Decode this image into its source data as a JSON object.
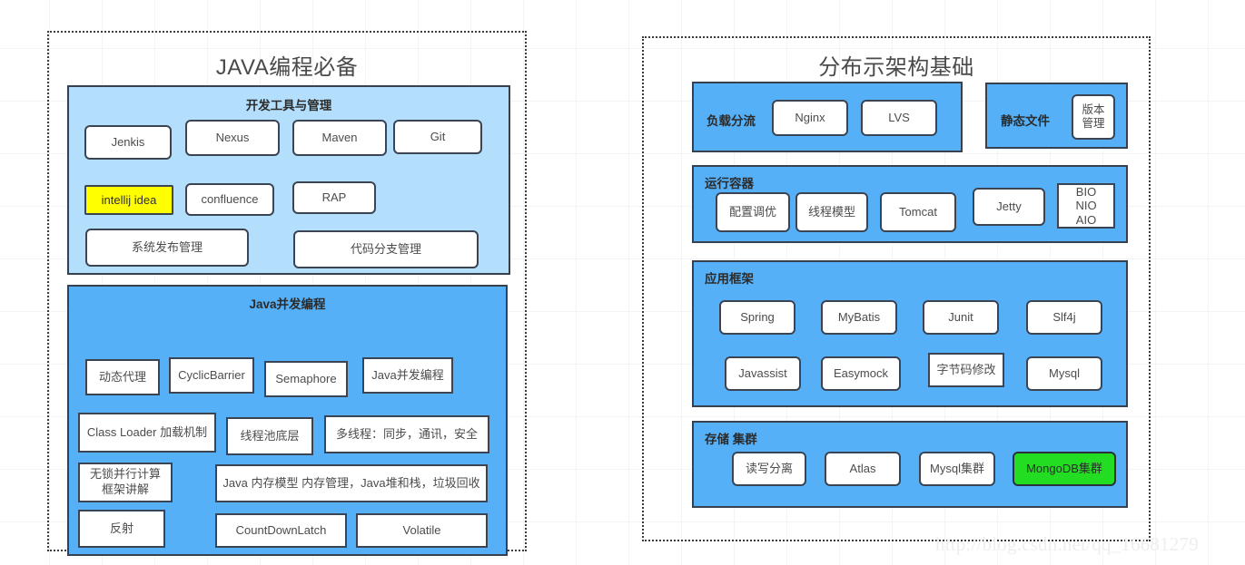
{
  "background": {
    "grid_color": "#f4f4f6",
    "page_color": "#ffffff"
  },
  "colors": {
    "light_blue": "#b3dffc",
    "solid_blue": "#56b0f7",
    "box_border": "#3b4452",
    "highlight_yellow": "#ffff00",
    "highlight_green": "#22dd22",
    "title_text": "#4a4a4a"
  },
  "left_panel": {
    "title": "JAVA编程必备",
    "groups": [
      {
        "title": "开发工具与管理",
        "items": [
          {
            "label": "Jenkis"
          },
          {
            "label": "Nexus"
          },
          {
            "label": "Maven"
          },
          {
            "label": "Git"
          },
          {
            "label": "intellij idea",
            "highlight": "yellow"
          },
          {
            "label": "confluence"
          },
          {
            "label": "RAP"
          },
          {
            "label": "系统发布管理"
          },
          {
            "label": "代码分支管理"
          }
        ]
      },
      {
        "title": "Java并发编程",
        "items": [
          {
            "label": "动态代理"
          },
          {
            "label": "CyclicBarrier"
          },
          {
            "label": "Semaphore"
          },
          {
            "label": "Java并发编程"
          },
          {
            "label": "Class Loader 加载机制"
          },
          {
            "label": "线程池底层"
          },
          {
            "label": "多线程：同步，通讯，安全"
          },
          {
            "label": "无锁并行计算\n框架讲解"
          },
          {
            "label": "Java 内存模型 内存管理，Java堆和栈，垃圾回收"
          },
          {
            "label": "反射"
          },
          {
            "label": "CountDownLatch"
          },
          {
            "label": "Volatile"
          }
        ]
      }
    ]
  },
  "right_panel": {
    "title": "分布示架构基础",
    "groups": [
      {
        "title": "负载分流",
        "title_style": "inline",
        "items": [
          {
            "label": "Nginx"
          },
          {
            "label": "LVS"
          }
        ]
      },
      {
        "title": "静态文件",
        "title_style": "inline",
        "items": [
          {
            "label": "版本\n管理"
          }
        ]
      },
      {
        "title": "运行容器",
        "items": [
          {
            "label": "配置调优"
          },
          {
            "label": "线程模型"
          },
          {
            "label": "Tomcat"
          },
          {
            "label": "Jetty"
          },
          {
            "label": "BIO\nNIO\nAIO"
          }
        ]
      },
      {
        "title": "应用框架",
        "items": [
          {
            "label": "Spring"
          },
          {
            "label": "MyBatis"
          },
          {
            "label": "Junit"
          },
          {
            "label": "Slf4j"
          },
          {
            "label": "Javassist"
          },
          {
            "label": "Easymock"
          },
          {
            "label": "字节码修改"
          },
          {
            "label": "Mysql"
          }
        ]
      },
      {
        "title": "存储 集群",
        "items": [
          {
            "label": "读写分离"
          },
          {
            "label": "Atlas"
          },
          {
            "label": "Mysql集群"
          },
          {
            "label": "MongoDB集群",
            "highlight": "green"
          }
        ]
      }
    ]
  },
  "watermark": "http://blog.csdn.net/qq_16681279"
}
